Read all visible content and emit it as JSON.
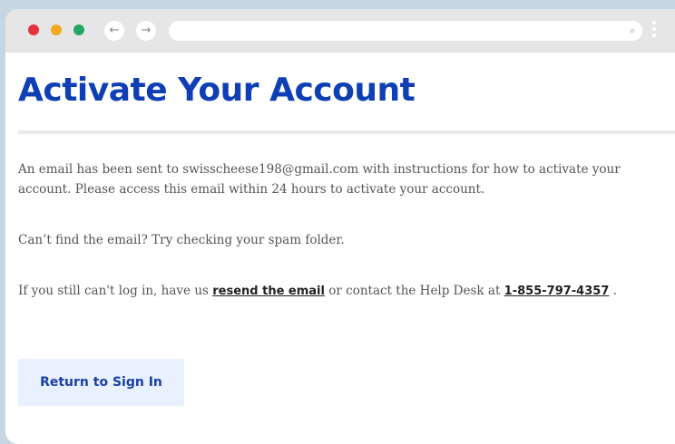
{
  "browser": {
    "back_icon": "←",
    "forward_icon": "→",
    "search_icon": "⌕",
    "dot_colors": {
      "red": "#e5323e",
      "yellow": "#f2a91e",
      "green": "#21a664"
    }
  },
  "page": {
    "title": "Activate Your Account",
    "paragraph1": "An email has been sent to swisscheese198@gmail.com with instructions for how to activate your account. Please access this email within 24 hours to activate your account.",
    "paragraph2": "Can’t find the email? Try checking your spam folder.",
    "paragraph3": {
      "before": "If you still can't log in, have us ",
      "resend_link": "resend the email",
      "middle": " or contact the Help Desk at ",
      "phone_link": "1-855-797-4357",
      "after": " ."
    },
    "return_button": "Return to Sign In"
  },
  "colors": {
    "title": "#0f3fb5",
    "button_bg": "#e8f1fd",
    "button_text": "#1b3fa6",
    "body_text": "#555555"
  }
}
